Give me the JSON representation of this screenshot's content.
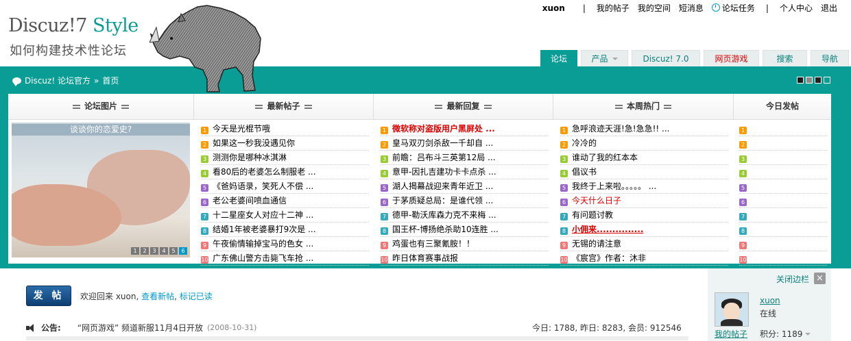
{
  "logo": {
    "main": "Discuz!7",
    "style": "Style",
    "subtitle": "如何构建技术性论坛"
  },
  "topnav": {
    "user": "xuon",
    "items": [
      "我的帖子",
      "我的空间",
      "短消息",
      "论坛任务",
      "个人中心",
      "退出"
    ]
  },
  "tabs": [
    {
      "label": "论坛",
      "state": "active"
    },
    {
      "label": "产品",
      "state": "dropdown"
    },
    {
      "label": "Discuz! 7.0",
      "state": "normal"
    },
    {
      "label": "网页游戏",
      "state": "red"
    },
    {
      "label": "搜索",
      "state": "normal"
    },
    {
      "label": "导航",
      "state": "normal"
    }
  ],
  "breadcrumb": {
    "site": "Discuz! 论坛官方",
    "sep": "»",
    "current": "首页"
  },
  "theme_swatches": [
    "#1a1a1a",
    "#888888",
    "#222222",
    "#0a9d95"
  ],
  "columns": {
    "pics": "论坛图片",
    "new_posts": "最新帖子",
    "new_replies": "最新回复",
    "weekly_hot": "本周热门",
    "today": "今日发帖"
  },
  "slideshow": {
    "caption": "谈谈你的恋爱史?",
    "pages": [
      "1",
      "2",
      "3",
      "4",
      "5",
      "6"
    ],
    "current_page": "6"
  },
  "new_posts": [
    "今天是光棍节哦",
    "如果这一秒我没遇见你",
    "测测你是哪种冰淇淋",
    "看80后的老婆怎么制服老 ...",
    "《爸妈语录，笑死人不偿 ...",
    "老公老婆间喷血通信",
    "十二星座女人对应十二神 ...",
    "结婚1年被老婆暴打9次是 ...",
    "午夜偷情输掉宝马的色女 ...",
    "广东佛山警方击毙飞车抢 ..."
  ],
  "new_replies": [
    "微软称对盗版用户黑屏处 ...",
    "皇马双刃剑杀敌一千却自 ...",
    "前瞻：吕布斗三英第12局 ...",
    "意甲-因扎吉建功卡卡点杀 ...",
    "湖人揭幕战迎来青年近卫 ...",
    "于茅质疑总局：是谁代领 ...",
    "德甲-勒沃库森力克不来梅 ...",
    "国王杯-博扬绝杀助10连胜 ...",
    "鸡蛋也有三聚氰胺！！",
    "昨日体育赛事战报"
  ],
  "weekly_hot": [
    "急呼浪迹天涯!急!急急!! ...",
    "冷冷的",
    "谁动了我的红本本",
    "倡议书",
    "我终于上来啦。。。。。 ...",
    "今天什么日子",
    "有问题讨教",
    "小佣来...............",
    "无锡的请注意",
    "《宸宫》作者：沐非"
  ],
  "today_count_rows": 10,
  "actions": {
    "post_button": "发 帖",
    "welcome": "欢迎回来 xuon,",
    "view_new": "查看新帖",
    "mark_read": "标记已读"
  },
  "notice": {
    "label": "公告:",
    "text": "“网页游戏” 频道新服11月4日开放",
    "date": "(2008-10-31)"
  },
  "stats": "今日: 1788, 昨日: 8283, 会员: 912546",
  "sidebar": {
    "close_label": "关闭边栏",
    "username": "xuon",
    "status": "在线",
    "my_posts": "我的帖子",
    "points": "积分: 1189"
  }
}
